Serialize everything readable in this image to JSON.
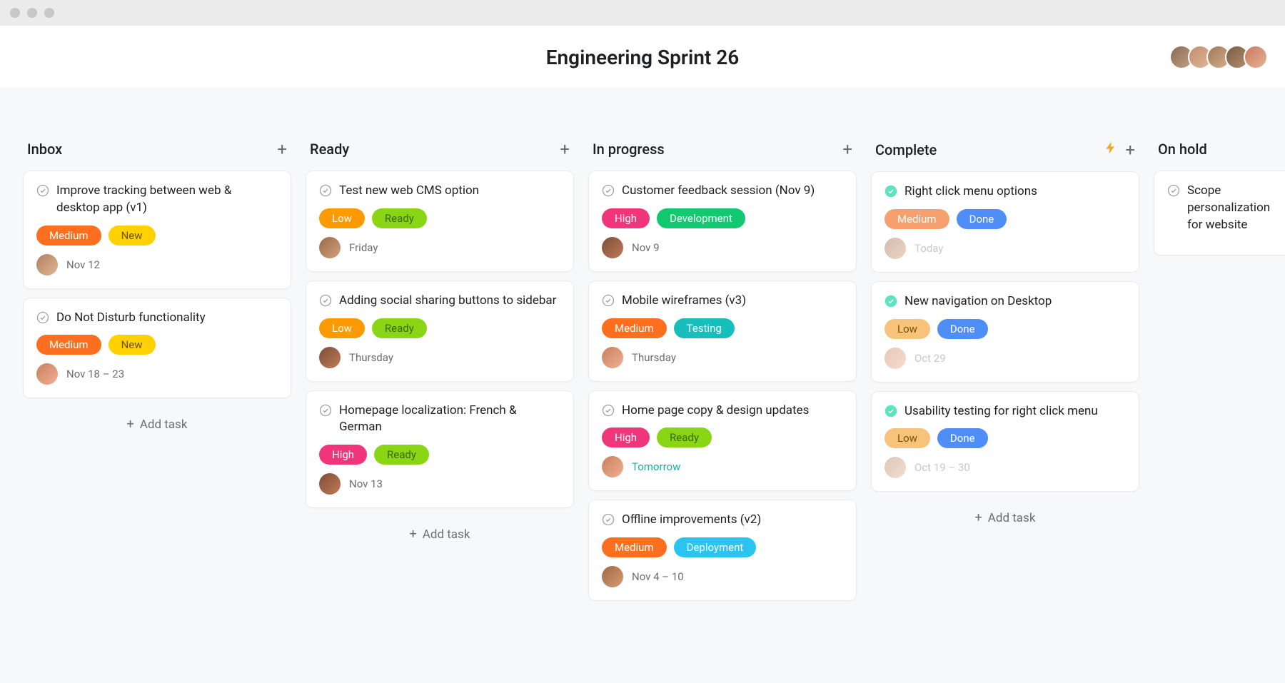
{
  "window": {
    "dots": 3
  },
  "header": {
    "title": "Engineering Sprint 26",
    "avatar_count": 5
  },
  "labels": {
    "add_task": "Add task"
  },
  "colors": {
    "medium_orange": "#fd6f1f",
    "new_yellow": "#ffd100",
    "low_orange": "#fd9a00",
    "ready_green": "#8bd614",
    "high_pink": "#f1357b",
    "development_green": "#12c971",
    "testing_teal": "#17bebb",
    "deployment_cyan": "#29c5f0",
    "done_blue": "#4f8ef7",
    "medium_peach": "#f5a06e",
    "low_peach": "#f7c37a"
  },
  "columns": [
    {
      "title": "Inbox",
      "has_bolt": false,
      "cards": [
        {
          "title": "Improve tracking between web & desktop app (v1)",
          "completed": false,
          "tags": [
            {
              "label": "Medium",
              "color": "medium_orange"
            },
            {
              "label": "New",
              "color": "new_yellow"
            }
          ],
          "avatar": "a",
          "date": "Nov 12",
          "date_style": "normal"
        },
        {
          "title": "Do Not Disturb functionality",
          "completed": false,
          "tags": [
            {
              "label": "Medium",
              "color": "medium_orange"
            },
            {
              "label": "New",
              "color": "new_yellow"
            }
          ],
          "avatar": "d",
          "date": "Nov 18 – 23",
          "date_style": "normal"
        }
      ],
      "show_add_task": true
    },
    {
      "title": "Ready",
      "has_bolt": false,
      "cards": [
        {
          "title": "Test new web CMS option",
          "completed": false,
          "tags": [
            {
              "label": "Low",
              "color": "low_orange"
            },
            {
              "label": "Ready",
              "color": "ready_green"
            }
          ],
          "avatar": "b",
          "date": "Friday",
          "date_style": "normal"
        },
        {
          "title": "Adding social sharing buttons to sidebar",
          "completed": false,
          "tags": [
            {
              "label": "Low",
              "color": "low_orange"
            },
            {
              "label": "Ready",
              "color": "ready_green"
            }
          ],
          "avatar": "c",
          "date": "Thursday",
          "date_style": "normal"
        },
        {
          "title": "Homepage localization: French & German",
          "completed": false,
          "tags": [
            {
              "label": "High",
              "color": "high_pink"
            },
            {
              "label": "Ready",
              "color": "ready_green"
            }
          ],
          "avatar": "c",
          "date": "Nov 13",
          "date_style": "normal"
        }
      ],
      "show_add_task": true
    },
    {
      "title": "In progress",
      "has_bolt": false,
      "cards": [
        {
          "title": "Customer feedback session (Nov 9)",
          "completed": false,
          "tags": [
            {
              "label": "High",
              "color": "high_pink"
            },
            {
              "label": "Development",
              "color": "development_green"
            }
          ],
          "avatar": "c",
          "date": "Nov 9",
          "date_style": "normal"
        },
        {
          "title": "Mobile wireframes (v3)",
          "completed": false,
          "tags": [
            {
              "label": "Medium",
              "color": "medium_orange"
            },
            {
              "label": "Testing",
              "color": "testing_teal"
            }
          ],
          "avatar": "d",
          "date": "Thursday",
          "date_style": "normal"
        },
        {
          "title": "Home page copy & design updates",
          "completed": false,
          "tags": [
            {
              "label": "High",
              "color": "high_pink"
            },
            {
              "label": "Ready",
              "color": "ready_green"
            }
          ],
          "avatar": "d",
          "date": "Tomorrow",
          "date_style": "soon"
        },
        {
          "title": "Offline improvements (v2)",
          "completed": false,
          "tags": [
            {
              "label": "Medium",
              "color": "medium_orange"
            },
            {
              "label": "Deployment",
              "color": "deployment_cyan"
            }
          ],
          "avatar": "e",
          "date": "Nov 4 – 10",
          "date_style": "normal"
        }
      ],
      "show_add_task": false
    },
    {
      "title": "Complete",
      "has_bolt": true,
      "cards": [
        {
          "title": "Right click menu options",
          "completed": true,
          "tags": [
            {
              "label": "Medium",
              "color": "medium_peach"
            },
            {
              "label": "Done",
              "color": "done_blue"
            }
          ],
          "avatar": "b",
          "avatar_faded": true,
          "date": "Today",
          "date_style": "faded"
        },
        {
          "title": "New navigation on Desktop",
          "completed": true,
          "tags": [
            {
              "label": "Low",
              "color": "low_peach"
            },
            {
              "label": "Done",
              "color": "done_blue"
            }
          ],
          "avatar": "d",
          "avatar_faded": true,
          "date": "Oct 29",
          "date_style": "faded"
        },
        {
          "title": "Usability testing for right click menu",
          "completed": true,
          "tags": [
            {
              "label": "Low",
              "color": "low_peach"
            },
            {
              "label": "Done",
              "color": "done_blue"
            }
          ],
          "avatar": "a",
          "avatar_faded": true,
          "date": "Oct 19 – 30",
          "date_style": "faded"
        }
      ],
      "show_add_task": true
    },
    {
      "title": "On hold",
      "has_bolt": false,
      "cards": [
        {
          "title": "Scope personalization for website",
          "completed": false,
          "tags": [],
          "avatar": null,
          "date": null
        }
      ],
      "show_add_task": false,
      "partial": true
    }
  ]
}
